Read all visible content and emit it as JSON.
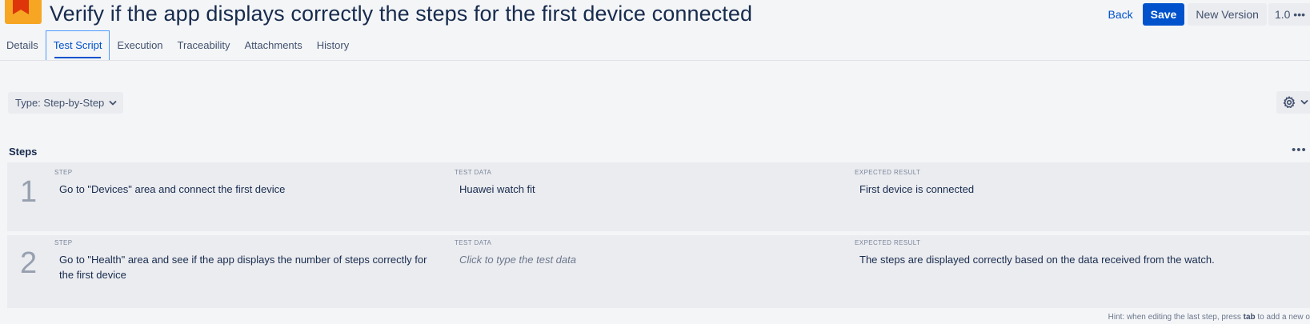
{
  "header": {
    "title": "Verify if the app displays correctly the steps for the first device connected",
    "back_label": "Back",
    "save_label": "Save",
    "new_version_label": "New Version",
    "version_label": "1.0 •••"
  },
  "tabs": [
    {
      "label": "Details"
    },
    {
      "label": "Test Script"
    },
    {
      "label": "Execution"
    },
    {
      "label": "Traceability"
    },
    {
      "label": "Attachments"
    },
    {
      "label": "History"
    }
  ],
  "active_tab": "Test Script",
  "type_select": {
    "label": "Type: Step-by-Step"
  },
  "steps_section": {
    "heading": "Steps",
    "more_label": "•••",
    "column_labels": {
      "step": "STEP",
      "test_data": "TEST DATA",
      "expected": "EXPECTED RESULT"
    },
    "steps": [
      {
        "number": "1",
        "step": "Go to \"Devices\" area and connect the first device",
        "test_data": "Huawei watch fit",
        "expected": "First device is connected"
      },
      {
        "number": "2",
        "step": "Go to \"Health\" area and see if the app displays the number of steps correctly for the first device",
        "test_data_placeholder": "Click to type the test data",
        "expected": "The steps are displayed correctly based on the data received from the watch."
      }
    ]
  },
  "hint": {
    "prefix": "Hint: when editing the last step, press ",
    "key": "tab",
    "suffix": " to add a new o"
  },
  "icons": {
    "logo": "project-logo-icon",
    "gear": "gear-icon",
    "chevron": "chevron-down-icon"
  },
  "colors": {
    "primary": "#0052cc",
    "background": "#f4f5f7",
    "card": "#ebecf0",
    "logo_orange": "#f6a623",
    "logo_red": "#de350b"
  }
}
